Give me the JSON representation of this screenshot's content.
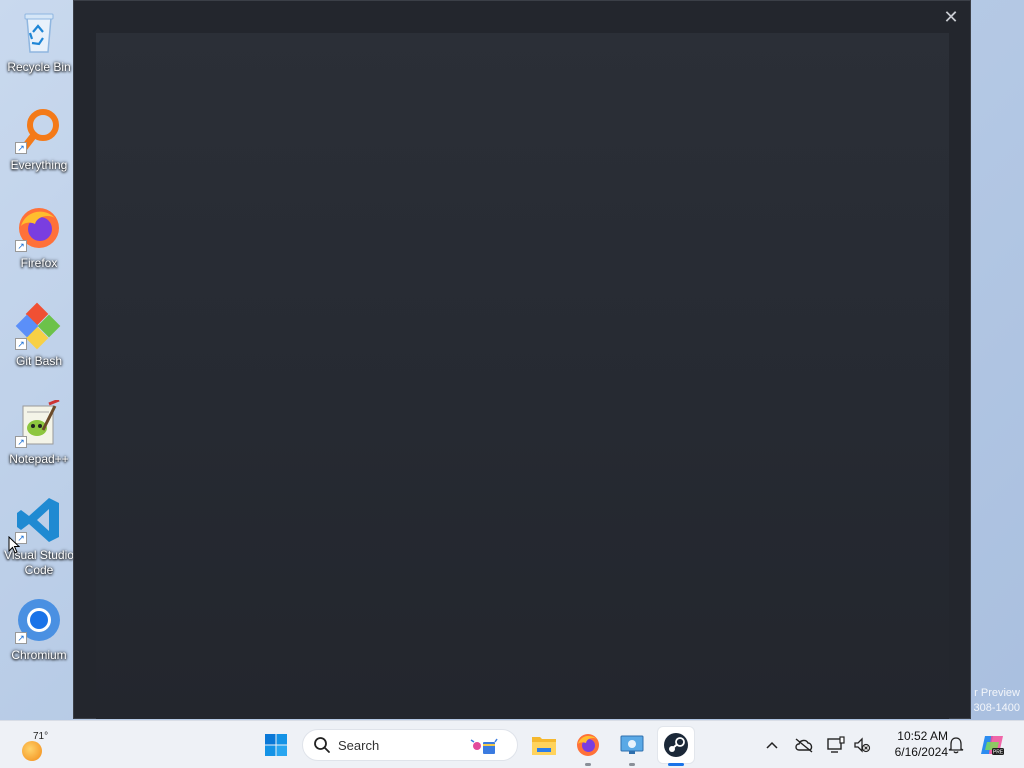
{
  "desktop": {
    "icons": [
      {
        "label": "Recycle Bin",
        "icon": "recycle-bin-icon"
      },
      {
        "label": "Everything",
        "icon": "everything-search-icon"
      },
      {
        "label": "Firefox",
        "icon": "firefox-icon"
      },
      {
        "label": "Git Bash",
        "icon": "git-bash-icon"
      },
      {
        "label": "Notepad++",
        "icon": "notepadpp-icon"
      },
      {
        "label": "Visual Studio Code",
        "icon": "vscode-icon"
      },
      {
        "label": "Chromium",
        "icon": "chromium-icon"
      }
    ],
    "watermark": {
      "line1": "r Preview",
      "line2": "308-1400"
    }
  },
  "window": {
    "close_symbol": "✕"
  },
  "taskbar": {
    "weather": {
      "temp": "71°"
    },
    "search_label": "Search",
    "pinned": [
      {
        "name": "file-explorer"
      },
      {
        "name": "firefox"
      },
      {
        "name": "remote-desktop"
      },
      {
        "name": "steam"
      }
    ],
    "tray": {
      "overflow_symbol": "^"
    },
    "clock": {
      "time": "10:52 AM",
      "date": "6/16/2024"
    }
  },
  "colors": {
    "window_bg": "#23262d",
    "accent": "#1a73e8"
  }
}
